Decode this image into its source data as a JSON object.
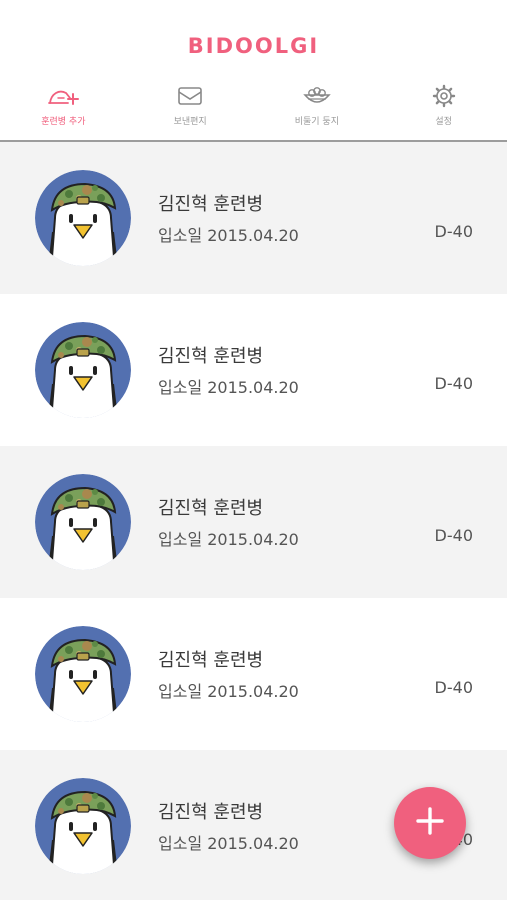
{
  "app": {
    "title": "BIDOOLGI",
    "accent_color": "#f0607e"
  },
  "tabs": [
    {
      "label": "훈련병 추가",
      "icon": "add-trainee-icon",
      "active": true
    },
    {
      "label": "보낸편지",
      "icon": "letter-icon",
      "active": false
    },
    {
      "label": "비둘기 둥지",
      "icon": "nest-icon",
      "active": false
    },
    {
      "label": "설정",
      "icon": "gear-icon",
      "active": false
    }
  ],
  "trainees": [
    {
      "name": "김진혁 훈련병",
      "enlist": "입소일 2015.04.20",
      "dday": "D-40"
    },
    {
      "name": "김진혁 훈련병",
      "enlist": "입소일 2015.04.20",
      "dday": "D-40"
    },
    {
      "name": "김진혁 훈련병",
      "enlist": "입소일 2015.04.20",
      "dday": "D-40"
    },
    {
      "name": "김진혁 훈련병",
      "enlist": "입소일 2015.04.20",
      "dday": "D-40"
    },
    {
      "name": "김진혁 훈련병",
      "enlist": "입소일 2015.04.20",
      "dday": "D-40"
    }
  ],
  "fab": {
    "icon": "plus-icon"
  }
}
